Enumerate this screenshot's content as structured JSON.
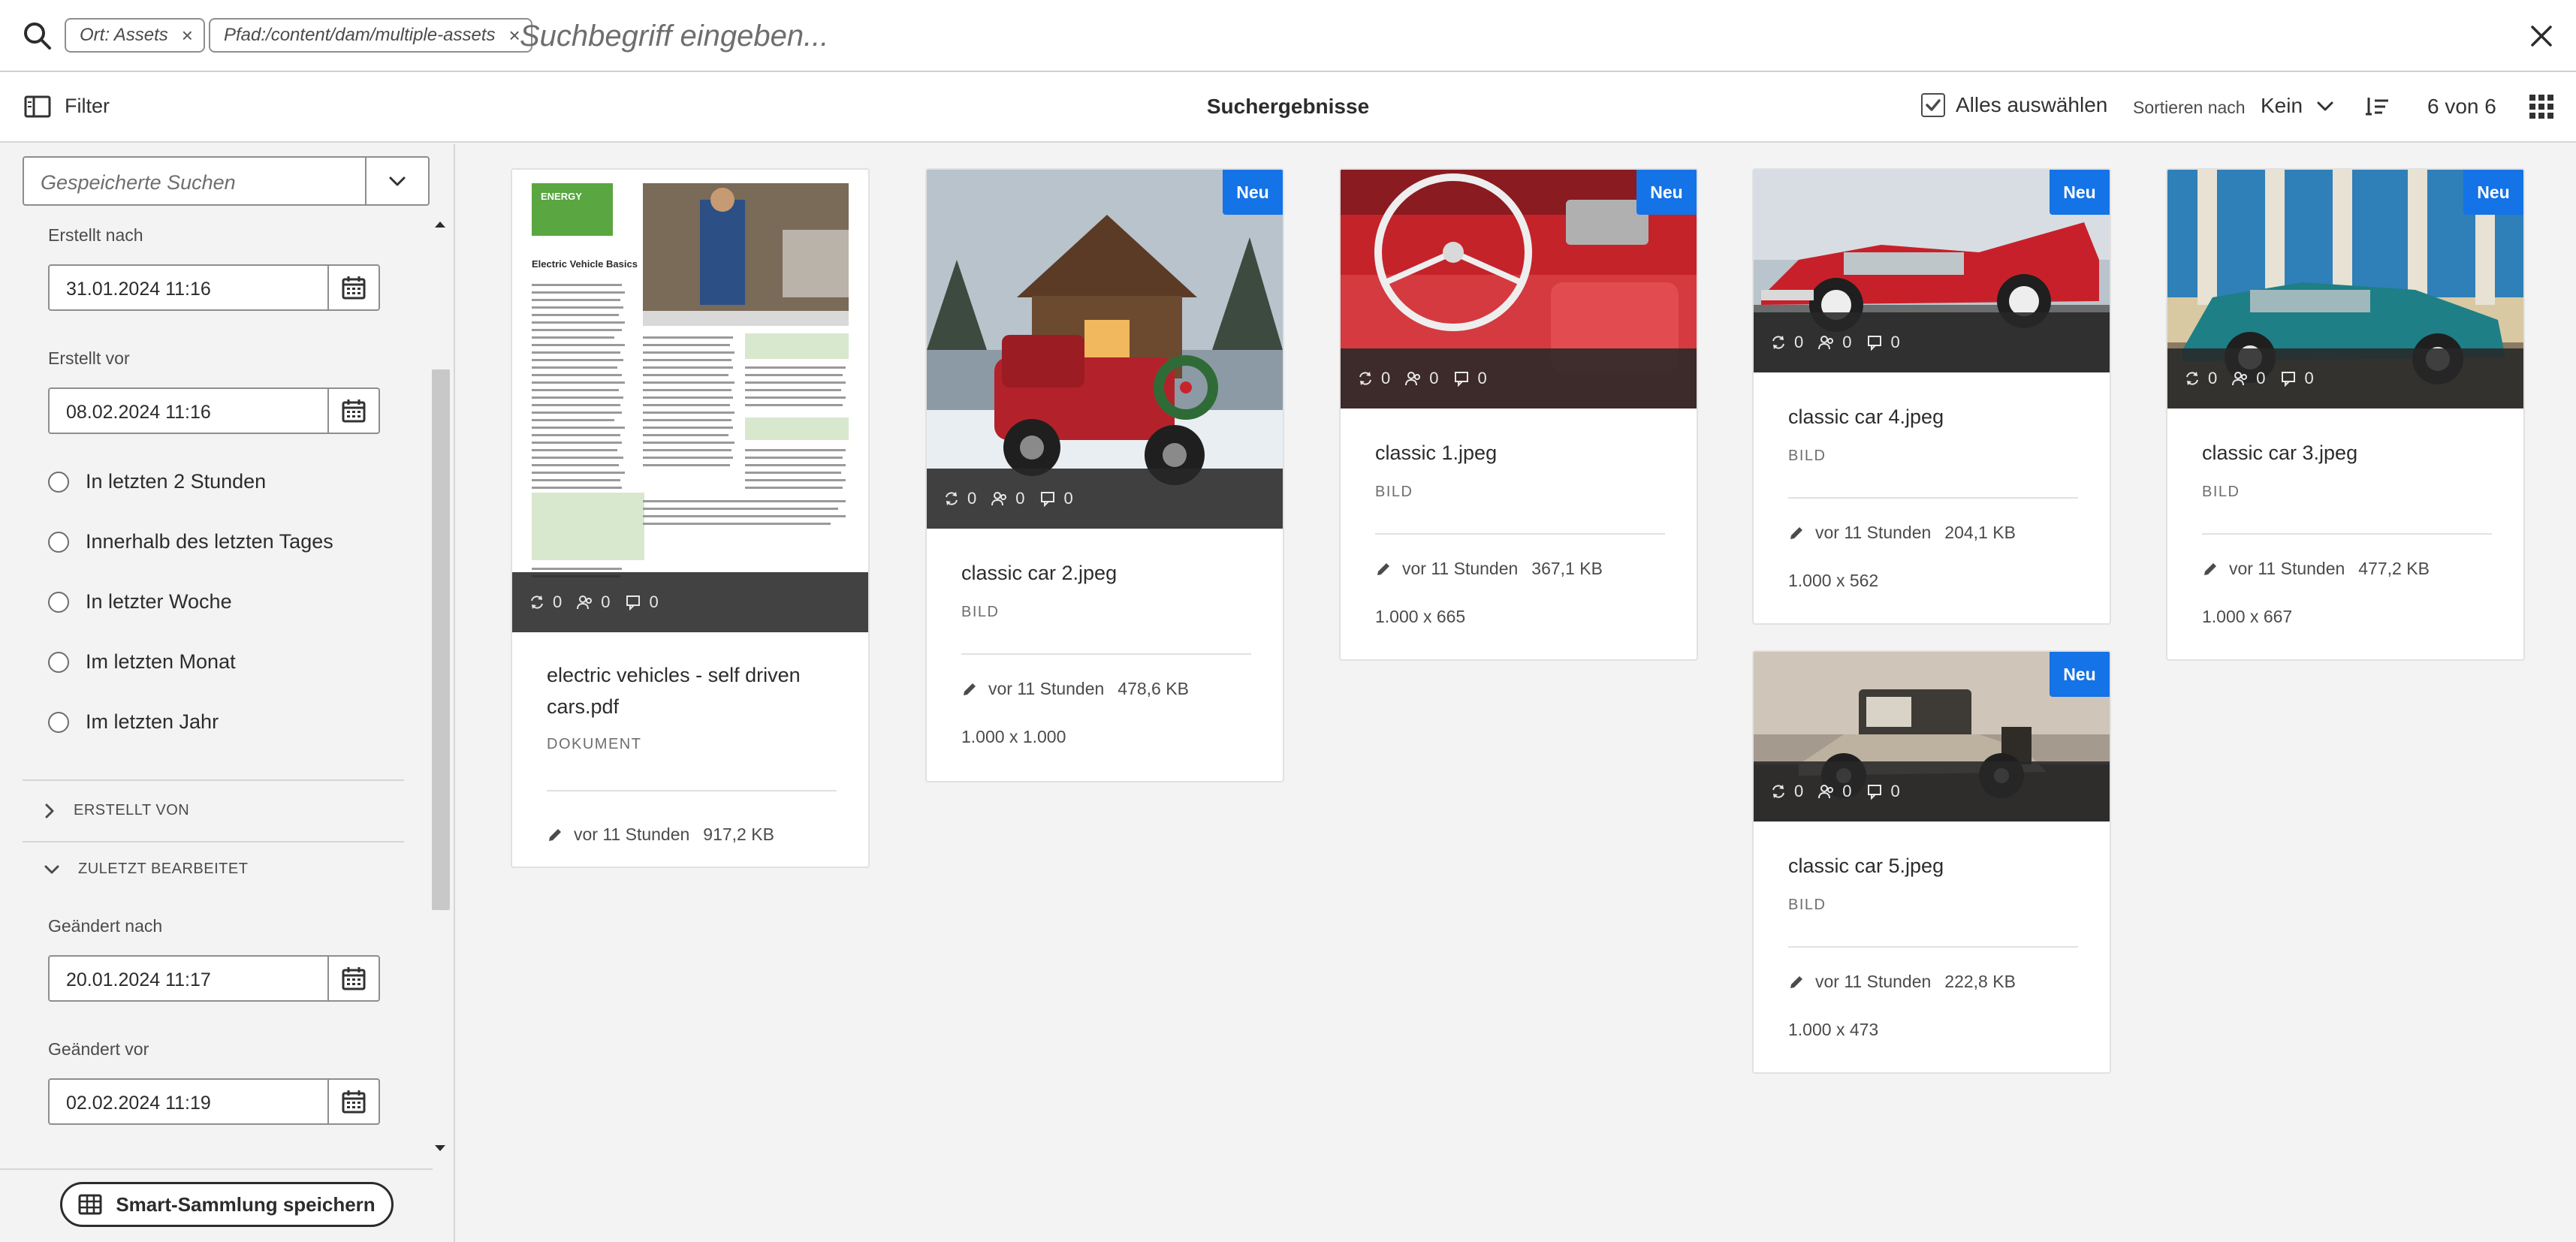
{
  "search": {
    "chips": [
      {
        "label": "Ort: Assets",
        "remove": "×"
      },
      {
        "label": "Pfad:/content/dam/multiple-assets",
        "remove": "×"
      }
    ],
    "placeholder": "Suchbegriff eingeben..."
  },
  "toolbar": {
    "filter_label": "Filter",
    "title": "Suchergebnisse",
    "select_all": "Alles auswählen",
    "sort_label": "Sortieren nach",
    "sort_value": "Kein",
    "count": "6 von 6"
  },
  "sidebar": {
    "saved_search_placeholder": "Gespeicherte Suchen",
    "created_after_label": "Erstellt nach",
    "created_after_value": "31.01.2024 11:16",
    "created_before_label": "Erstellt vor",
    "created_before_value": "08.02.2024 11:16",
    "radios": [
      "In letzten 2 Stunden",
      "Innerhalb des letzten Tages",
      "In letzter Woche",
      "Im letzten Monat",
      "Im letzten Jahr"
    ],
    "section_created_by": "ERSTELLT VON",
    "section_last_modified": "ZULETZT BEARBEITET",
    "modified_after_label": "Geändert nach",
    "modified_after_value": "20.01.2024 11:17",
    "modified_before_label": "Geändert vor",
    "modified_before_value": "02.02.2024 11:19",
    "smart_collection_button": "Smart-Sammlung speichern"
  },
  "cards": [
    {
      "title": "electric vehicles - self driven cars.pdf",
      "type": "DOKUMENT",
      "modified": "vor 11 Stunden",
      "size": "917,2 KB",
      "dimensions": "",
      "badge": "",
      "stats": [
        "0",
        "0",
        "0"
      ]
    },
    {
      "title": "classic car 2.jpeg",
      "type": "BILD",
      "modified": "vor 11 Stunden",
      "size": "478,6 KB",
      "dimensions": "1.000 x 1.000",
      "badge": "Neu",
      "stats": [
        "0",
        "0",
        "0"
      ]
    },
    {
      "title": "classic 1.jpeg",
      "type": "BILD",
      "modified": "vor 11 Stunden",
      "size": "367,1 KB",
      "dimensions": "1.000 x 665",
      "badge": "Neu",
      "stats": [
        "0",
        "0",
        "0"
      ]
    },
    {
      "title": "classic car 4.jpeg",
      "type": "BILD",
      "modified": "vor 11 Stunden",
      "size": "204,1 KB",
      "dimensions": "1.000 x 562",
      "badge": "Neu",
      "stats": [
        "0",
        "0",
        "0"
      ]
    },
    {
      "title": "classic car 3.jpeg",
      "type": "BILD",
      "modified": "vor 11 Stunden",
      "size": "477,2 KB",
      "dimensions": "1.000 x 667",
      "badge": "Neu",
      "stats": [
        "0",
        "0",
        "0"
      ]
    },
    {
      "title": "classic car 5.jpeg",
      "type": "BILD",
      "modified": "vor 11 Stunden",
      "size": "222,8 KB",
      "dimensions": "1.000 x 473",
      "badge": "Neu",
      "stats": [
        "0",
        "0",
        "0"
      ]
    }
  ],
  "pdf_preview": {
    "brand": "ENERGY",
    "heading": "Electric Vehicle Basics"
  },
  "colors": {
    "accent": "#1473e6",
    "overlay": "#2d2d2d",
    "background": "#f3f3f3"
  }
}
